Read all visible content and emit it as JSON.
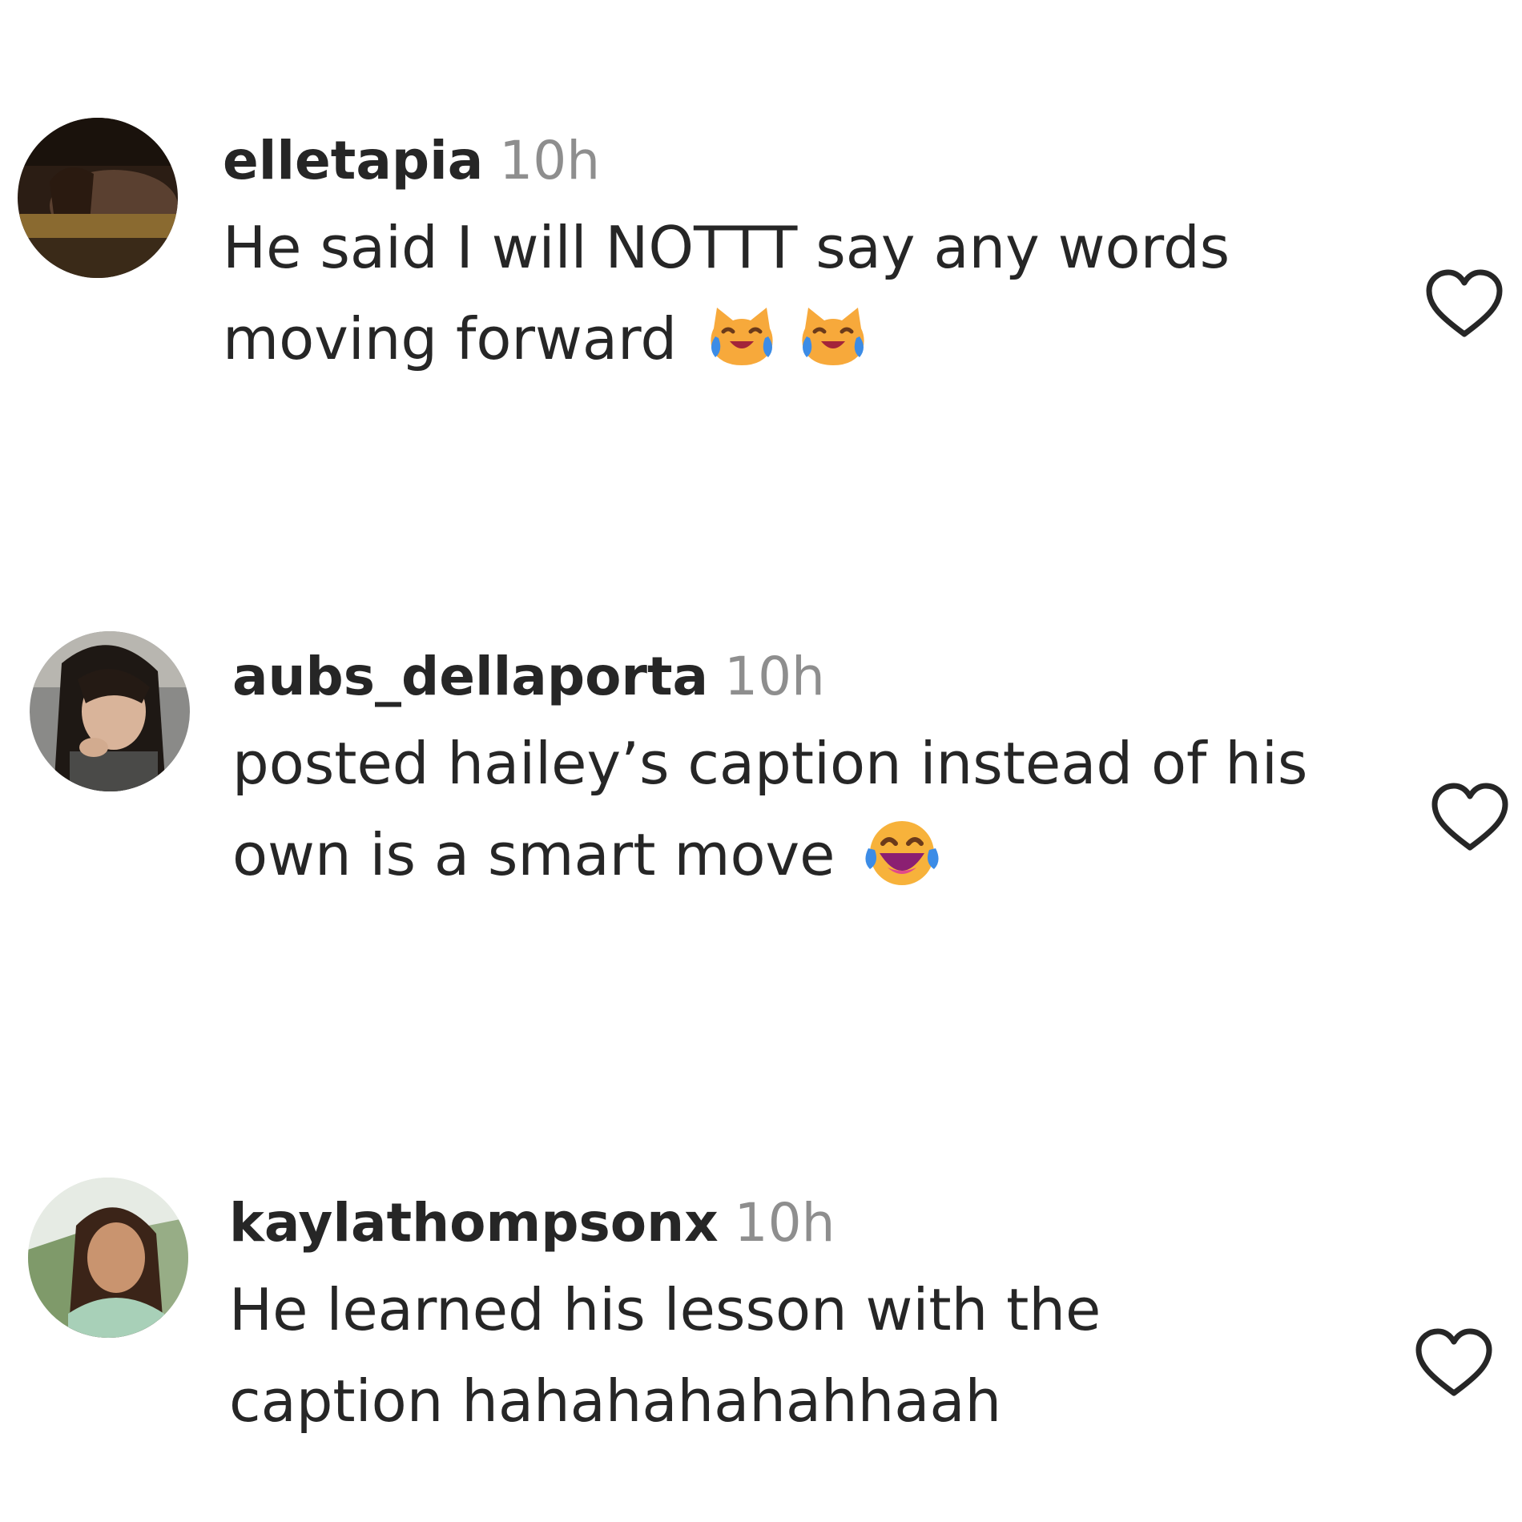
{
  "comments": [
    {
      "username": "elletapia",
      "time": "10h",
      "line1": "He said I will NOTTT say any words",
      "line2": "moving forward",
      "emojis": [
        "cat-tears-of-joy-emoji",
        "cat-tears-of-joy-emoji"
      ]
    },
    {
      "username": "aubs_dellaporta",
      "time": "10h",
      "line1": "posted hailey’s caption instead of his",
      "line2": "own is a smart move",
      "emojis": [
        "face-tears-of-joy-emoji"
      ]
    },
    {
      "username": "kaylathompsonx",
      "time": "10h",
      "line1": "He learned his lesson with the",
      "line2": "caption hahahahahahhaah",
      "emojis": []
    }
  ],
  "icons": {
    "like": "heart-outline-icon"
  },
  "colors": {
    "text": "#262626",
    "muted": "#8e8e8e",
    "background": "#ffffff"
  }
}
